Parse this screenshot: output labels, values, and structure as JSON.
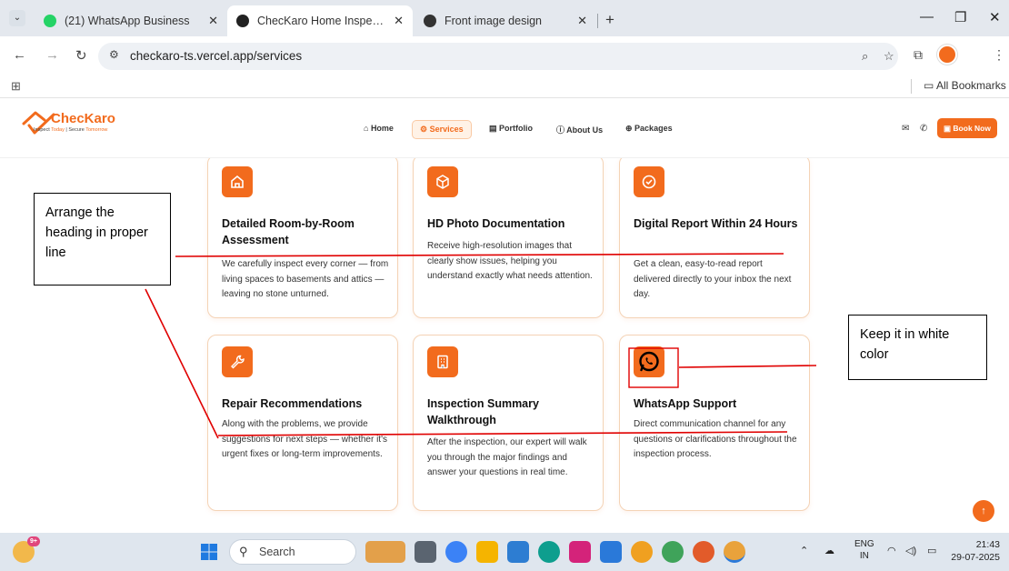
{
  "browser": {
    "tabs": [
      {
        "label": "(21) WhatsApp Business",
        "favicon_color": "#25d366"
      },
      {
        "label": "ChecKaro Home Inspection - In",
        "favicon_color": "#222222"
      },
      {
        "label": "Front image design",
        "favicon_color": "#333333"
      }
    ],
    "url": "checkaro-ts.vercel.app/services",
    "bookmarks_label": "All Bookmarks"
  },
  "site": {
    "logo_name": "ChecKaro",
    "logo_tag_1": "Inspect ",
    "logo_tag_2": "Today",
    "logo_tag_3": " | Secure ",
    "logo_tag_4": "Tomorrow",
    "nav": [
      "Home",
      "Services",
      "Portfolio",
      "About Us",
      "Packages"
    ],
    "book_now": "Book Now",
    "accent": "#f26b1d"
  },
  "services": [
    {
      "title": "Detailed Room-by-Room Assessment",
      "desc": "We carefully inspect every corner — from living spaces to basements and attics — leaving no stone unturned.",
      "icon": "home-icon"
    },
    {
      "title": "HD Photo Documentation",
      "desc": "Receive high-resolution images that clearly show issues, helping you understand exactly what needs attention.",
      "icon": "cube-icon"
    },
    {
      "title": "Digital Report Within 24 Hours",
      "desc": "Get a clean, easy-to-read report delivered directly to your inbox the next day.",
      "icon": "check-circle-icon"
    },
    {
      "title": "Repair Recommendations",
      "desc": "Along with the problems, we provide suggestions for next steps — whether it's urgent fixes or long-term improvements.",
      "icon": "wrench-icon"
    },
    {
      "title": "Inspection Summary Walkthrough",
      "desc": "After the inspection, our expert will walk you through the major findings and answer your questions in real time.",
      "icon": "building-icon"
    },
    {
      "title": "WhatsApp Support",
      "desc": "Direct communication channel for any questions or clarifications throughout the inspection process.",
      "icon": "whatsapp-icon"
    }
  ],
  "annotations": {
    "note_left": "Arrange the heading in proper line",
    "note_right": "Keep it in white color"
  },
  "taskbar": {
    "search_placeholder": "Search",
    "badge": "9+",
    "lang_1": "ENG",
    "lang_2": "IN",
    "time": "21:43",
    "date": "29-07-2025"
  }
}
